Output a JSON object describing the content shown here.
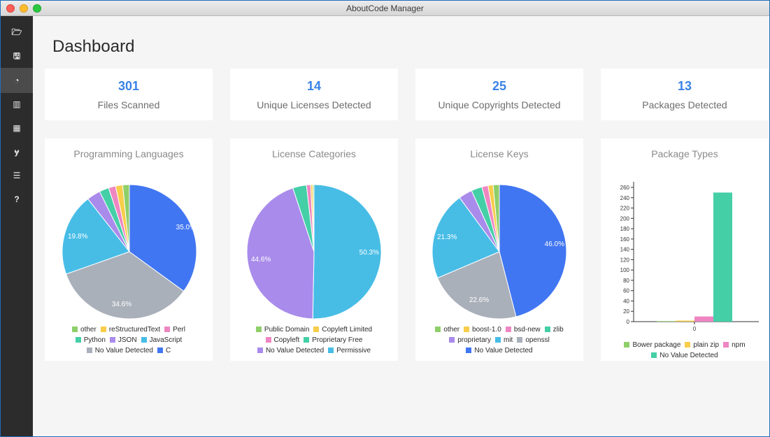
{
  "window": {
    "title": "AboutCode Manager"
  },
  "sidebar": {
    "items": [
      {
        "id": "folder",
        "icon": "folder-open-icon",
        "glyph": "🗁"
      },
      {
        "id": "save",
        "icon": "save-icon",
        "glyph": "🖫"
      },
      {
        "id": "dashboard",
        "icon": "dashboard-icon",
        "glyph": "◔",
        "active": true
      },
      {
        "id": "chart",
        "icon": "bar-chart-icon",
        "glyph": "▥"
      },
      {
        "id": "table",
        "icon": "table-icon",
        "glyph": "▦"
      },
      {
        "id": "license",
        "icon": "license-icon",
        "glyph": "ɏ"
      },
      {
        "id": "list",
        "icon": "list-icon",
        "glyph": "☰"
      },
      {
        "id": "help",
        "icon": "help-icon",
        "glyph": "?"
      }
    ]
  },
  "page": {
    "title": "Dashboard"
  },
  "stats": [
    {
      "value": "301",
      "label": "Files Scanned"
    },
    {
      "value": "14",
      "label": "Unique Licenses Detected"
    },
    {
      "value": "25",
      "label": "Unique Copyrights Detected"
    },
    {
      "value": "13",
      "label": "Packages Detected"
    }
  ],
  "chart_data": [
    {
      "type": "pie",
      "title": "Programming Languages",
      "slices": [
        {
          "label": "C",
          "value": 35.0,
          "color": "#4176f2"
        },
        {
          "label": "No Value Detected",
          "value": 34.6,
          "color": "#aab0ba"
        },
        {
          "label": "JavaScript",
          "value": 19.8,
          "color": "#47bde6"
        },
        {
          "label": "JSON",
          "value": 3.3,
          "color": "#a98beb"
        },
        {
          "label": "Python",
          "value": 2.3,
          "color": "#44cfa7"
        },
        {
          "label": "Perl",
          "value": 1.7,
          "color": "#ee86c2"
        },
        {
          "label": "reStructuredText",
          "value": 1.7,
          "color": "#f7cd4a"
        },
        {
          "label": "other",
          "value": 1.6,
          "color": "#8fcf6a"
        }
      ],
      "slice_labels": [
        "35.0%",
        "34.6%",
        "19.8%"
      ],
      "legend_lines": [
        [
          "other",
          "reStructuredText",
          "Perl"
        ],
        [
          "Python",
          "JSON",
          "JavaScript"
        ],
        [
          "No Value Detected",
          "C"
        ]
      ]
    },
    {
      "type": "pie",
      "title": "License Categories",
      "slices": [
        {
          "label": "Permissive",
          "value": 50.3,
          "color": "#47bde6"
        },
        {
          "label": "No Value Detected",
          "value": 44.6,
          "color": "#a98beb"
        },
        {
          "label": "Proprietary Free",
          "value": 3.3,
          "color": "#44cfa7"
        },
        {
          "label": "Copyleft",
          "value": 1.0,
          "color": "#ee86c2"
        },
        {
          "label": "Copyleft Limited",
          "value": 0.5,
          "color": "#f7cd4a"
        },
        {
          "label": "Public Domain",
          "value": 0.3,
          "color": "#8fcf6a"
        }
      ],
      "slice_labels": [
        "50.3%",
        "44.6%"
      ],
      "legend_lines": [
        [
          "Public Domain",
          "Copyleft Limited"
        ],
        [
          "Copyleft",
          "Proprietary Free"
        ],
        [
          "No Value Detected",
          "Permissive"
        ]
      ]
    },
    {
      "type": "pie",
      "title": "License Keys",
      "slices": [
        {
          "label": "No Value Detected",
          "value": 46.0,
          "color": "#4176f2"
        },
        {
          "label": "openssl",
          "value": 22.6,
          "color": "#aab0ba"
        },
        {
          "label": "mit",
          "value": 21.3,
          "color": "#47bde6"
        },
        {
          "label": "proprietary",
          "value": 3.3,
          "color": "#a98beb"
        },
        {
          "label": "zlib",
          "value": 2.6,
          "color": "#44cfa7"
        },
        {
          "label": "bsd-new",
          "value": 1.5,
          "color": "#ee86c2"
        },
        {
          "label": "boost-1.0",
          "value": 1.2,
          "color": "#f7cd4a"
        },
        {
          "label": "other",
          "value": 1.5,
          "color": "#8fcf6a"
        }
      ],
      "slice_labels": [
        "46.0%",
        "22.6%",
        "21.3%"
      ],
      "legend_lines": [
        [
          "other",
          "boost-1.0",
          "bsd-new",
          "zlib"
        ],
        [
          "proprietary",
          "mit",
          "openssl"
        ],
        [
          "No Value Detected"
        ]
      ]
    },
    {
      "type": "bar",
      "title": "Package Types",
      "categories": [
        "0"
      ],
      "series": [
        {
          "name": "Bower package",
          "values": [
            1
          ],
          "color": "#8fcf6a"
        },
        {
          "name": "plain zip",
          "values": [
            2
          ],
          "color": "#f7cd4a"
        },
        {
          "name": "npm",
          "values": [
            10
          ],
          "color": "#ee86c2"
        },
        {
          "name": "No Value Detected",
          "values": [
            250
          ],
          "color": "#44cfa7"
        }
      ],
      "ylim": [
        0,
        260
      ],
      "yticks": [
        "0",
        "20",
        "40",
        "60",
        "80",
        "100",
        "120",
        "140",
        "160",
        "180",
        "200",
        "220",
        "240",
        "260"
      ],
      "legend_lines": [
        [
          "Bower package",
          "plain zip",
          "npm"
        ],
        [
          "No Value Detected"
        ]
      ]
    }
  ]
}
